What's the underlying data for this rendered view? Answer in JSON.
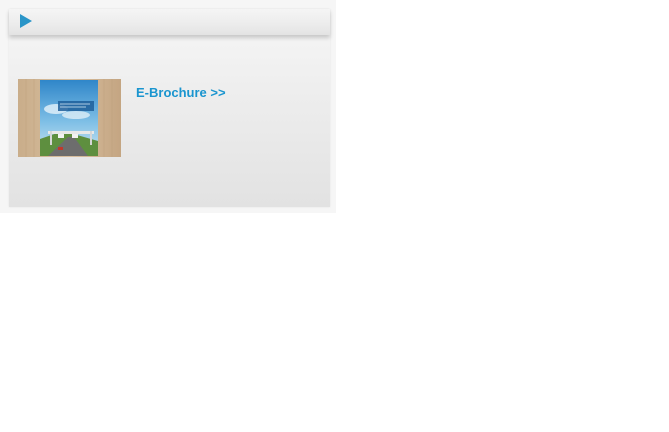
{
  "widget": {
    "header": {
      "icon": "play-arrow-icon",
      "accent_color": "#2a95c8"
    },
    "item": {
      "thumbnail_icon": "brochure-cover-image",
      "link_label": "E-Brochure >>",
      "link_color": "#1a95cf"
    }
  }
}
